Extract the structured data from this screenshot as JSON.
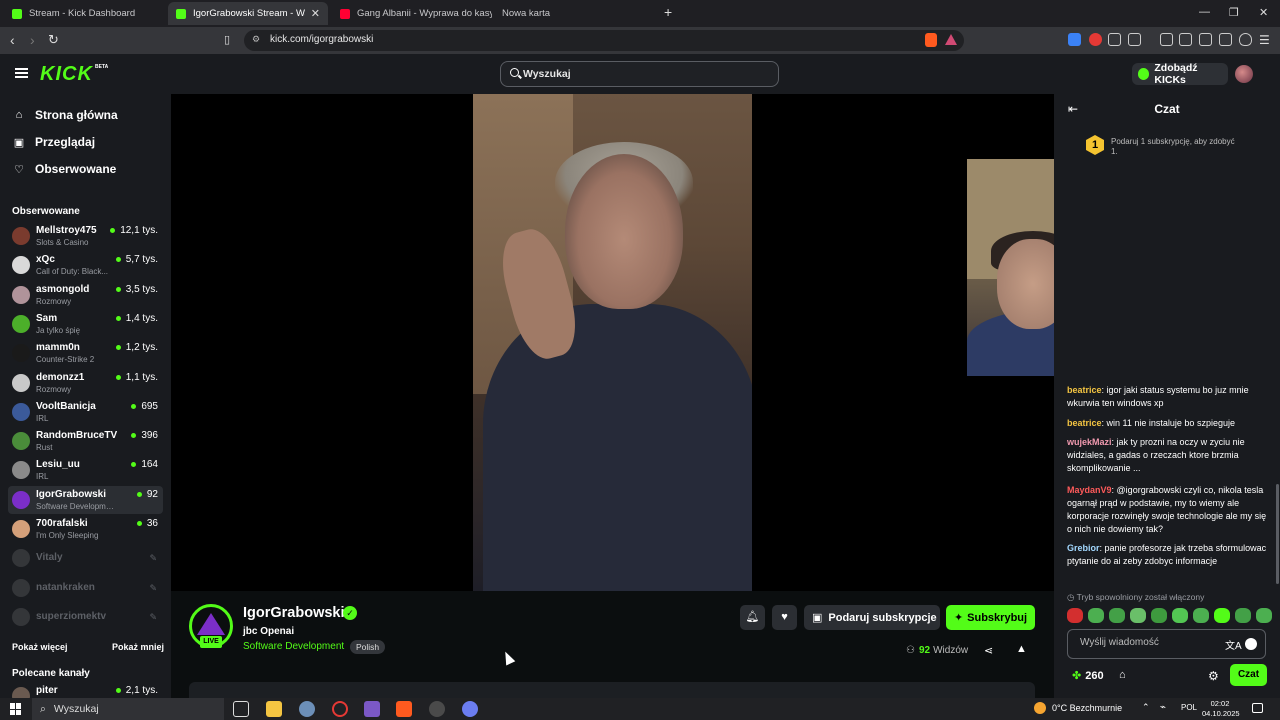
{
  "browser": {
    "tabs": [
      {
        "title": "Stream - Kick Dashboard",
        "favicon_color": "#53fc18"
      },
      {
        "title": "IgorGrabowski Stream - Watch",
        "favicon_color": "#53fc18"
      },
      {
        "title": "Gang Albanii - Wyprawa do kasyna -",
        "favicon_color": "#ff0033"
      },
      {
        "title": "Nowa karta",
        "favicon_color": ""
      }
    ],
    "new_tab": "+",
    "url": "kick.com/igorgrabowski"
  },
  "header": {
    "logo": "KICK",
    "logo_badge": "BETA",
    "search_placeholder": "Wyszukaj",
    "get_kicks": "Zdobądź KICKs"
  },
  "sidebar": {
    "nav": [
      {
        "label": "Strona główna",
        "icon": "home-icon"
      },
      {
        "label": "Przeglądaj",
        "icon": "browse-icon"
      },
      {
        "label": "Obserwowane",
        "icon": "heart-icon"
      }
    ],
    "followed_title": "Obserwowane",
    "channels": [
      {
        "name": "Mellstroy475",
        "category": "Slots & Casino",
        "viewers": "12,1 tys.",
        "avatar_color": "#7a3b2e"
      },
      {
        "name": "xQc",
        "category": "Call of Duty: Black...",
        "viewers": "5,7 tys.",
        "avatar_color": "#d9d9d9"
      },
      {
        "name": "asmongold",
        "category": "Rozmowy",
        "viewers": "3,5 tys.",
        "avatar_color": "#b0939a"
      },
      {
        "name": "Sam",
        "category": "Ja tylko śpię",
        "viewers": "1,4 tys.",
        "avatar_color": "#4caf2a"
      },
      {
        "name": "mamm0n",
        "category": "Counter-Strike 2",
        "viewers": "1,2 tys.",
        "avatar_color": "#1a1a1a"
      },
      {
        "name": "demonzz1",
        "category": "Rozmowy",
        "viewers": "1,1 tys.",
        "avatar_color": "#c9c9c9"
      },
      {
        "name": "VooltBanicja",
        "category": "IRL",
        "viewers": "695",
        "avatar_color": "#3b5a9a"
      },
      {
        "name": "RandomBruceTV",
        "category": "Rust",
        "viewers": "396",
        "avatar_color": "#4a8c3a"
      },
      {
        "name": "Lesiu_uu",
        "category": "IRL",
        "viewers": "164",
        "avatar_color": "#8a8a8a"
      },
      {
        "name": "IgorGrabowski",
        "category": "Software Development",
        "viewers": "92",
        "avatar_color": "#7b2ec8"
      },
      {
        "name": "700rafalski",
        "category": "I'm Only Sleeping",
        "viewers": "36",
        "avatar_color": "#d4a07a"
      }
    ],
    "offline_channels": [
      {
        "name": "Vitaly"
      },
      {
        "name": "natankraken"
      },
      {
        "name": "superziomektv"
      }
    ],
    "show_more": "Pokaż więcej",
    "show_less": "Pokaż mniej",
    "recommended_title": "Polecane kanały",
    "recommended_partial": {
      "name": "piter",
      "viewers": "2,1 tys."
    }
  },
  "stream": {
    "streamer": "IgorGrabowski",
    "live_badge": "LIVE",
    "title": "jbc Openai",
    "category": "Software Development",
    "language": "Polish",
    "gift_label": "Podaruj subskrypcje",
    "subscribe_label": "Subskrybuj",
    "viewers_count": "92",
    "viewers_label": "Widzów"
  },
  "chat": {
    "title": "Czat",
    "pinned": {
      "badge": "1",
      "text": "Podaruj 1 subskrypcję, aby zdobyć 1."
    },
    "messages": [
      {
        "user": "beatrice",
        "user_color": "#f4c542",
        "text": "igor jaki status systemu bo juz mnie wkurwia ten windows xp"
      },
      {
        "user": "beatrice",
        "user_color": "#f4c542",
        "text": "win 11 nie instaluje bo szpieguje"
      },
      {
        "user": "wujekMazi",
        "user_color": "#f29ab0",
        "text": "jak ty prozni na oczy w zyciu nie widziales, a gadas o rzeczach ktore brzmia skomplikowanie ..."
      },
      {
        "user": "MaydanV9",
        "user_color": "#ff5a5a",
        "text": "@igorgrabowski czyli co, nikola tesla ogarnął prąd w podstawie, my to wiemy ale korporacje rozwinęły swoje technologie ale my się o nich nie dowiemy tak?"
      },
      {
        "user": "Grebior",
        "user_color": "#a3d8ff",
        "text": "panie profesorze jak trzeba sformulowac ptytanie do ai zeby zdobyc informacje"
      }
    ],
    "slow_mode": "Tryb spowolniony został włączony",
    "input_placeholder": "Wyślij wiadomość",
    "points": "260",
    "send_label": "Czat"
  },
  "taskbar": {
    "search_placeholder": "Wyszukaj",
    "weather": "0°C  Bezchmurnie",
    "language": "POL",
    "time": "02:02",
    "date": "04.10.2025"
  }
}
